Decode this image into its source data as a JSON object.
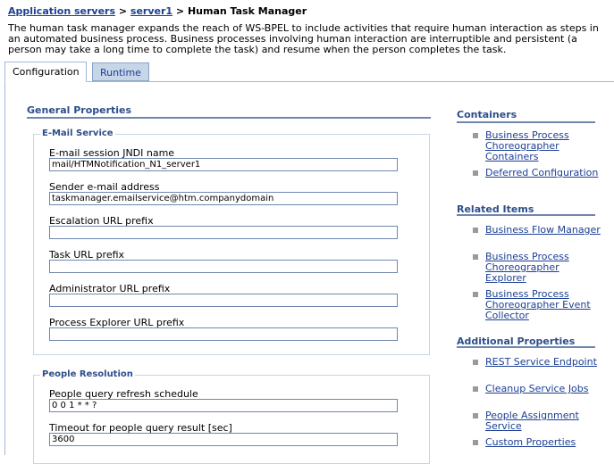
{
  "breadcrumb": {
    "link1": "Application servers",
    "sep1": " > ",
    "link2": "server1",
    "sep2": " > ",
    "current": "Human Task Manager"
  },
  "intro": "The human task manager expands the reach of WS-BPEL to include activities that require human interaction as steps in an automated business process. Business processes involving human interaction are interruptible and persistent (a person may take a long time to complete the task) and resume when the person completes the task.",
  "tabs": {
    "configuration": "Configuration",
    "runtime": "Runtime"
  },
  "general": {
    "title": "General Properties",
    "email": {
      "title": "E-Mail Service",
      "fields": [
        {
          "label": "E-mail session JNDI name",
          "value": "mail/HTMNotification_N1_server1"
        },
        {
          "label": "Sender e-mail address",
          "value": "taskmanager.emailservice@htm.companydomain"
        },
        {
          "label": "Escalation URL prefix",
          "value": ""
        },
        {
          "label": "Task URL prefix",
          "value": ""
        },
        {
          "label": "Administrator URL prefix",
          "value": ""
        },
        {
          "label": "Process Explorer URL prefix",
          "value": ""
        }
      ]
    },
    "people": {
      "title": "People Resolution",
      "fields": [
        {
          "label": "People query refresh schedule",
          "value": "0 0 1 * * ?"
        },
        {
          "label": "Timeout for people query result [sec]",
          "value": "3600"
        }
      ]
    }
  },
  "sidebar": {
    "containers": {
      "title": "Containers",
      "items": [
        "Business Process Choreographer Containers",
        "Deferred Configuration"
      ]
    },
    "related": {
      "title": "Related Items",
      "items": [
        "Business Flow Manager",
        "Business Process Choreographer Explorer",
        "Business Process Choreographer Event Collector"
      ]
    },
    "additional": {
      "title": "Additional Properties",
      "items": [
        "REST Service Endpoint",
        "Cleanup Service Jobs",
        "People Assignment Service",
        "Custom Properties"
      ]
    }
  }
}
